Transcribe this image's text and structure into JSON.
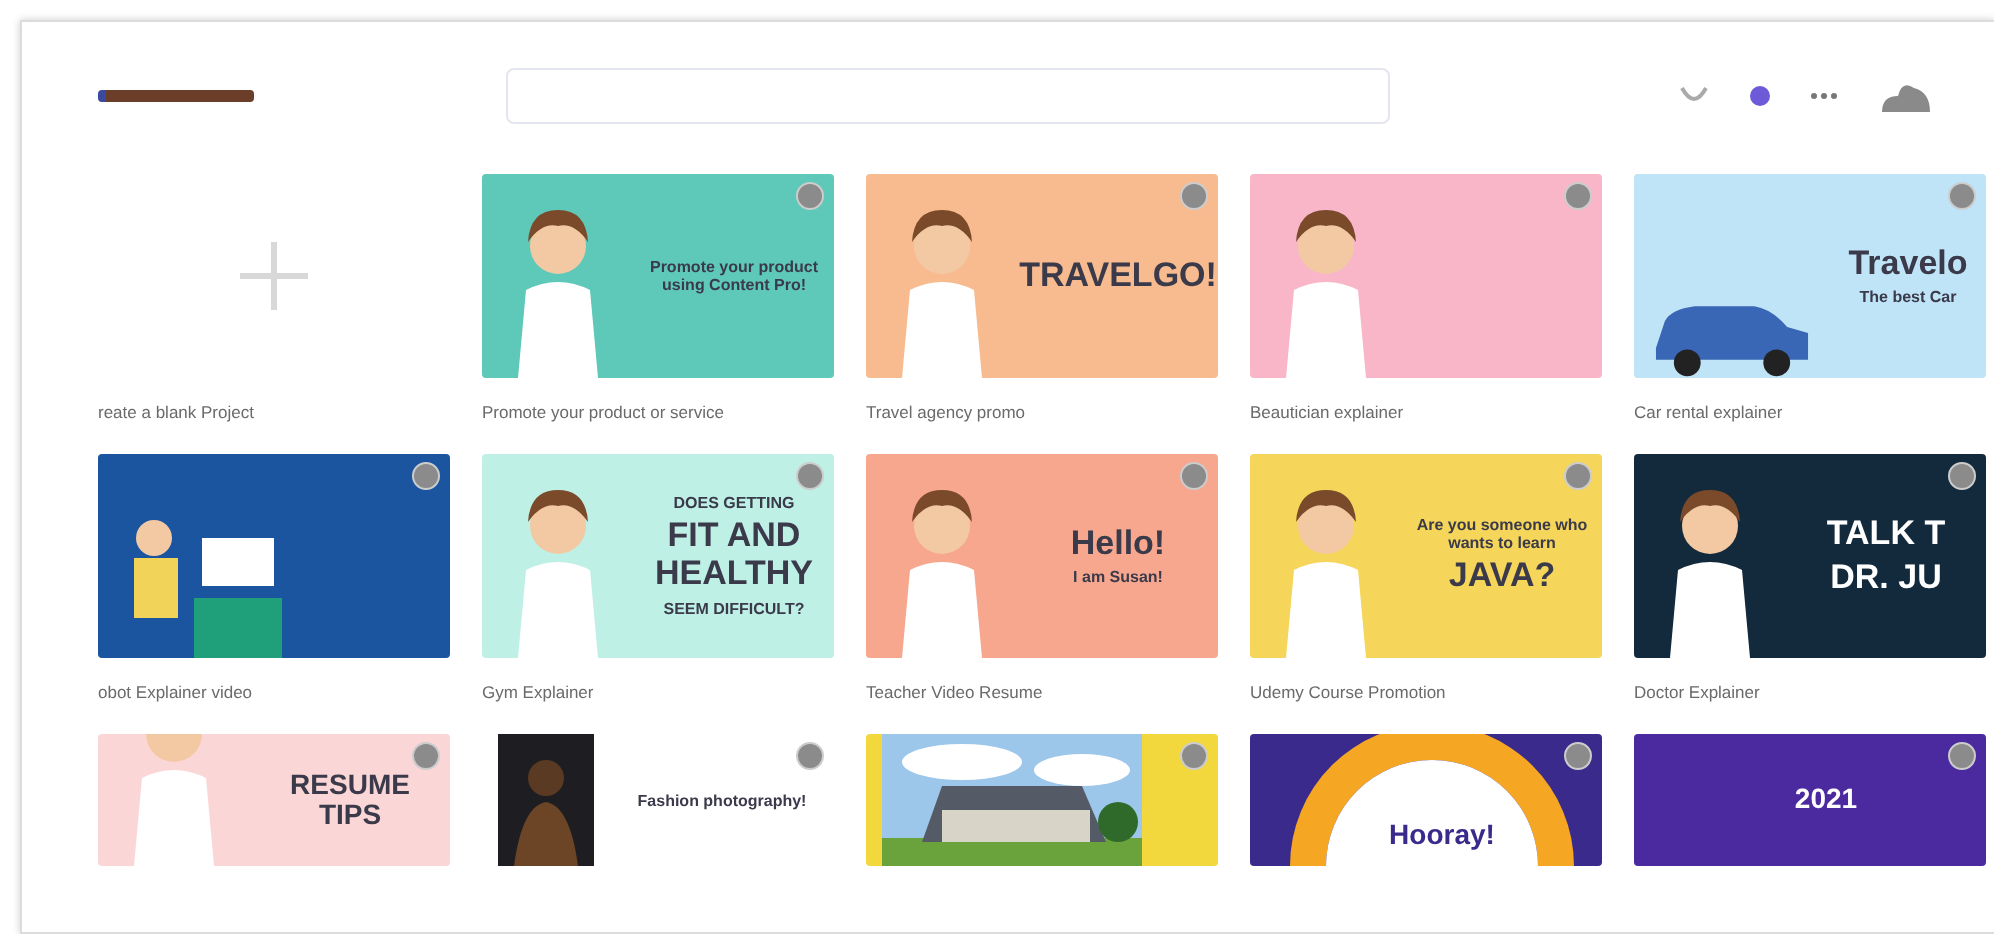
{
  "blank_project": {
    "caption": "reate a blank Project"
  },
  "templates": [
    {
      "caption": "Promote your product or service",
      "color": "#5ec9b9",
      "kind": "person",
      "texts": [
        {
          "text": "Promote your product using Content Pro!",
          "kind": "body"
        }
      ]
    },
    {
      "caption": "Travel agency promo",
      "color": "#f7bb8f",
      "kind": "person",
      "texts": [
        {
          "text": "TRAVELGO!",
          "kind": "heading"
        }
      ]
    },
    {
      "caption": "Beautician explainer",
      "color": "#f8b6c8",
      "kind": "person"
    },
    {
      "caption": "Car rental explainer",
      "color": "#bfe3f7",
      "kind": "car",
      "texts": [
        {
          "text": "Travelo",
          "kind": "heading"
        },
        {
          "text": "The best Car",
          "kind": "body"
        }
      ]
    },
    {
      "caption": "obot Explainer video",
      "color": "#1b55a0",
      "kind": "computer"
    },
    {
      "caption": "Gym Explainer",
      "color": "#bff0e6",
      "kind": "person",
      "texts": [
        {
          "text": "DOES GETTING",
          "kind": "body"
        },
        {
          "text": "FIT AND HEALTHY",
          "kind": "heading"
        },
        {
          "text": "SEEM DIFFICULT?",
          "kind": "body"
        }
      ]
    },
    {
      "caption": "Teacher Video Resume",
      "color": "#f6a78e",
      "kind": "person",
      "texts": [
        {
          "text": "Hello!",
          "kind": "heading"
        },
        {
          "text": "I am Susan!",
          "kind": "body"
        }
      ]
    },
    {
      "caption": "Udemy Course Promotion",
      "color": "#f6d65a",
      "kind": "person",
      "texts": [
        {
          "text": "Are you someone who wants to learn",
          "kind": "body"
        },
        {
          "text": "JAVA?",
          "kind": "heading"
        }
      ]
    },
    {
      "caption": "Doctor Explainer",
      "color": "#132a3c",
      "kind": "person",
      "texts": [
        {
          "text": "TALK T",
          "kind": "heading"
        },
        {
          "text": "DR. JU",
          "kind": "heading"
        }
      ]
    },
    {
      "color": "#fbd6d6",
      "kind": "person",
      "texts": [
        {
          "text": "RESUME TIPS",
          "kind": "heading"
        }
      ]
    },
    {
      "color": "#ffffff",
      "texts": [
        {
          "text": "Fashion photography!",
          "kind": "body"
        }
      ]
    },
    {
      "color": "#f2d83c",
      "kind": "house"
    },
    {
      "color": "#3a2a8c",
      "kind": "ring",
      "texts": [
        {
          "text": "Hooray!",
          "kind": "heading"
        }
      ]
    },
    {
      "color": "#4b2aa0",
      "kind": "plain",
      "texts": [
        {
          "text": "2021",
          "kind": "heading"
        }
      ]
    }
  ]
}
